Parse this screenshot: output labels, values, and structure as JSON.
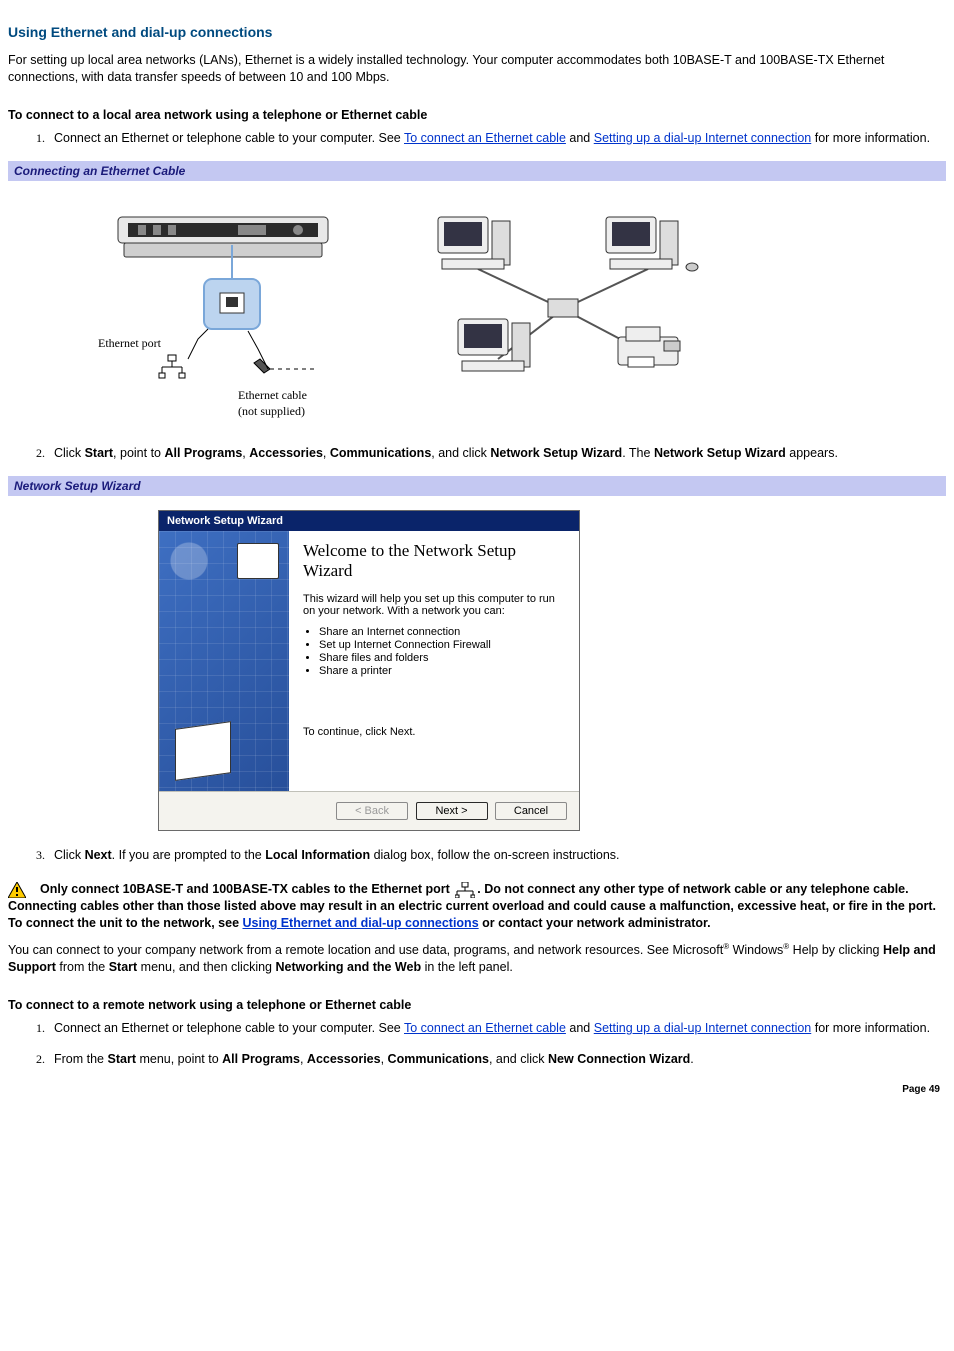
{
  "title": "Using Ethernet and dial-up connections",
  "intro": "For setting up local area networks (LANs), Ethernet is a widely installed technology. Your computer accommodates both 10BASE-T and 100BASE-TX Ethernet connections, with data transfer speeds of between 10 and 100 Mbps.",
  "sub1": "To connect to a local area network using a telephone or Ethernet cable",
  "step1": {
    "pre": "Connect an Ethernet or telephone cable to your computer. See ",
    "link1": "To connect an Ethernet cable",
    "mid": " and ",
    "link2": "Setting up a dial-up Internet connection",
    "post": " for more information."
  },
  "caption1": "Connecting an Ethernet Cable",
  "fig1": {
    "port_label": "Ethernet port",
    "cable_label_1": "Ethernet cable",
    "cable_label_2": "(not supplied)"
  },
  "step2": {
    "t1": "Click ",
    "b1": "Start",
    "t2": ", point to ",
    "b2": "All Programs",
    "t3": ", ",
    "b3": "Accessories",
    "t4": ", ",
    "b4": "Communications",
    "t5": ", and click ",
    "b5": "Network Setup Wizard",
    "t6": ". The ",
    "b6": "Network Setup Wizard",
    "t7": " appears."
  },
  "caption2": "Network Setup Wizard",
  "wizard": {
    "title": "Network Setup Wizard",
    "heading": "Welcome to the Network Setup Wizard",
    "desc": "This wizard will help you set up this computer to run on your network. With a network you can:",
    "bullets": [
      "Share an Internet connection",
      "Set up Internet Connection Firewall",
      "Share files and folders",
      "Share a printer"
    ],
    "continue": "To continue, click Next.",
    "back": "< Back",
    "next": "Next >",
    "cancel": "Cancel"
  },
  "step3": {
    "t1": "Click ",
    "b1": "Next",
    "t2": ". If you are prompted to the ",
    "b2": "Local Information",
    "t3": " dialog box, follow the on-screen instructions."
  },
  "warning": {
    "pre": "Only connect 10BASE-T and 100BASE-TX cables to the Ethernet port ",
    "mid": ". Do not connect any other type of network cable or any telephone cable. Connecting cables other than those listed above may result in an electric current overload and could cause a malfunction, excessive heat, or fire in the port. To connect the unit to the network, see ",
    "link": "Using Ethernet and dial-up connections",
    "post": " or contact your network administrator."
  },
  "remote_intro": {
    "t1": "You can connect to your company network from a remote location and use data, programs, and network resources. See Microsoft",
    "t2": " Windows",
    "t3": " Help by clicking ",
    "b1": "Help and Support",
    "t4": " from the ",
    "b2": "Start",
    "t5": " menu, and then clicking ",
    "b3": "Networking and the Web",
    "t6": " in the left panel."
  },
  "sub2": "To connect to a remote network using a telephone or Ethernet cable",
  "rstep1": {
    "pre": "Connect an Ethernet or telephone cable to your computer. See ",
    "link1": "To connect an Ethernet cable",
    "mid": " and ",
    "link2": "Setting up a dial-up Internet connection",
    "post": " for more information."
  },
  "rstep2": {
    "t1": "From the ",
    "b1": "Start",
    "t2": " menu, point to ",
    "b2": "All Programs",
    "t3": ", ",
    "b3": "Accessories",
    "t4": ", ",
    "b4": "Communications",
    "t5": ", and click ",
    "b5": "New Connection Wizard",
    "t6": "."
  },
  "page_num": "Page 49",
  "reg": "®"
}
